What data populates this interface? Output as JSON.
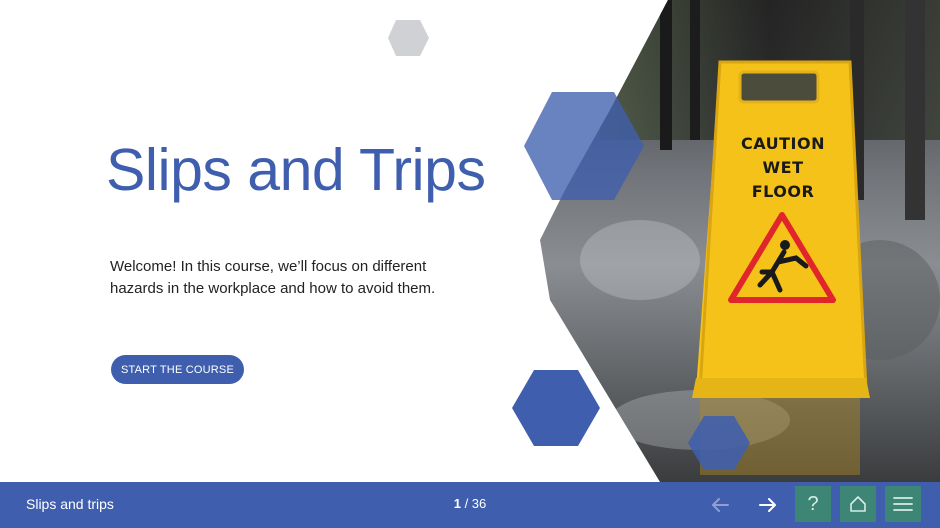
{
  "slide": {
    "title": "Slips and Trips",
    "intro": "Welcome! In this course, we’ll focus on different hazards in the workplace and how to avoid them.",
    "start_button": "START THE COURSE",
    "sign": {
      "line1": "CAUTION",
      "line2": "WET",
      "line3": "FLOOR"
    }
  },
  "footer": {
    "course_title": "Slips and trips",
    "page_current": "1",
    "page_total": "/ 36",
    "icons": {
      "prev": "arrow-left-icon",
      "next": "arrow-right-icon",
      "help": "question-mark-icon",
      "home": "home-icon",
      "menu": "hamburger-menu-icon"
    }
  },
  "colors": {
    "accent": "#3f5fae",
    "footer_buttons": "#3d8575",
    "sign_yellow": "#f5c21a",
    "warning_red": "#e0262a"
  }
}
